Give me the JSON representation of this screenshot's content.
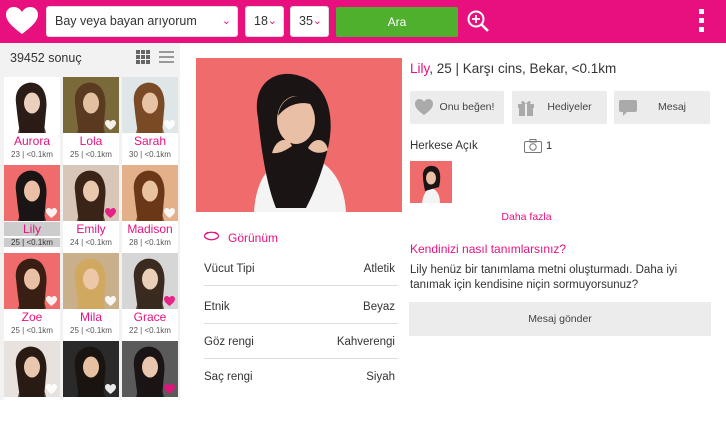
{
  "topbar": {
    "gender_select": "Bay veya bayan arıyorum",
    "age_min": "18",
    "age_max": "35",
    "search_button": "Ara",
    "accent": "#e8107f",
    "search_button_color": "#4fb02d"
  },
  "results": {
    "count": "39452 sonuç"
  },
  "cards": [
    {
      "name": "Aurora",
      "meta": "23 | <0.1km"
    },
    {
      "name": "Lola",
      "meta": "25 | <0.1km"
    },
    {
      "name": "Sarah",
      "meta": "30 | <0.1km"
    },
    {
      "name": "Lily",
      "meta": "25 | <0.1km"
    },
    {
      "name": "Emily",
      "meta": "24 | <0.1km"
    },
    {
      "name": "Madison",
      "meta": "28 | <0.1km"
    },
    {
      "name": "Zoe",
      "meta": "25 | <0.1km"
    },
    {
      "name": "Mila",
      "meta": "25 | <0.1km"
    },
    {
      "name": "Grace",
      "meta": "22 | <0.1km"
    },
    {
      "name": "",
      "meta": ""
    },
    {
      "name": "",
      "meta": ""
    },
    {
      "name": "",
      "meta": ""
    }
  ],
  "profile": {
    "name": "Lily",
    "summary": ", 25 | Karşı cins, Bekar, <0.1km",
    "actions": {
      "like": "Onu beğen!",
      "gifts": "Hediyeler",
      "message": "Mesaj"
    },
    "public_label": "Herkese Açık",
    "photo_count": "1",
    "more": "Daha fazla",
    "describe_question": "Kendinizi nasıl tanımlarsınız?",
    "describe_text": "Lily henüz bir tanımlama metni oluşturmadı. Daha iyi tanımak için kendisine niçin sormuyorsunuz?",
    "send_message": "Mesaj gönder",
    "appearance_label": "Görünüm",
    "attributes": [
      {
        "key": "Vücut Tipi",
        "value": "Atletik"
      },
      {
        "key": "Etnik",
        "value": "Beyaz"
      },
      {
        "key": "Göz rengi",
        "value": "Kahverengi"
      },
      {
        "key": "Saç rengi",
        "value": "Siyah"
      }
    ]
  }
}
